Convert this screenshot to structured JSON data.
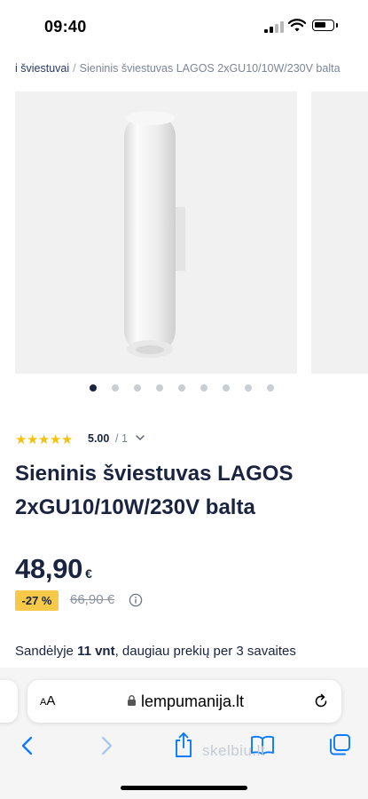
{
  "status_bar": {
    "time": "09:40"
  },
  "breadcrumb": {
    "link": "i šviestuvai",
    "separator": "/",
    "current": "Sieninis šviestuvas LAGOS 2xGU10/10W/230V balta"
  },
  "gallery": {
    "dot_count": 9,
    "active_index": 0
  },
  "rating": {
    "stars": 5,
    "score": "5.00",
    "count": "/ 1"
  },
  "product": {
    "title": "Sieninis šviestuvas LAGOS 2xGU10/10W/230V balta",
    "price": "48,90",
    "currency": "€",
    "discount": "-27 %",
    "old_price": "66,90 €"
  },
  "stock": {
    "prefix": "Sandėlyje ",
    "quantity": "11 vnt",
    "suffix": ", daugiau prekių per 3 savaites"
  },
  "browser": {
    "aa_label_small": "A",
    "aa_label_big": "A",
    "url": "lempumanija.lt"
  },
  "watermark": "skelbiu.lt",
  "colors": {
    "accent": "#1a2340",
    "star": "#f3c20c",
    "badge": "#f7c948",
    "ios_blue": "#0a7aff"
  },
  "icons": [
    "signal-icon",
    "wifi-icon",
    "battery-icon",
    "chevron-down-icon",
    "info-icon",
    "lock-icon",
    "reload-icon",
    "back-icon",
    "forward-icon",
    "share-icon",
    "bookmarks-icon",
    "tabs-icon"
  ]
}
